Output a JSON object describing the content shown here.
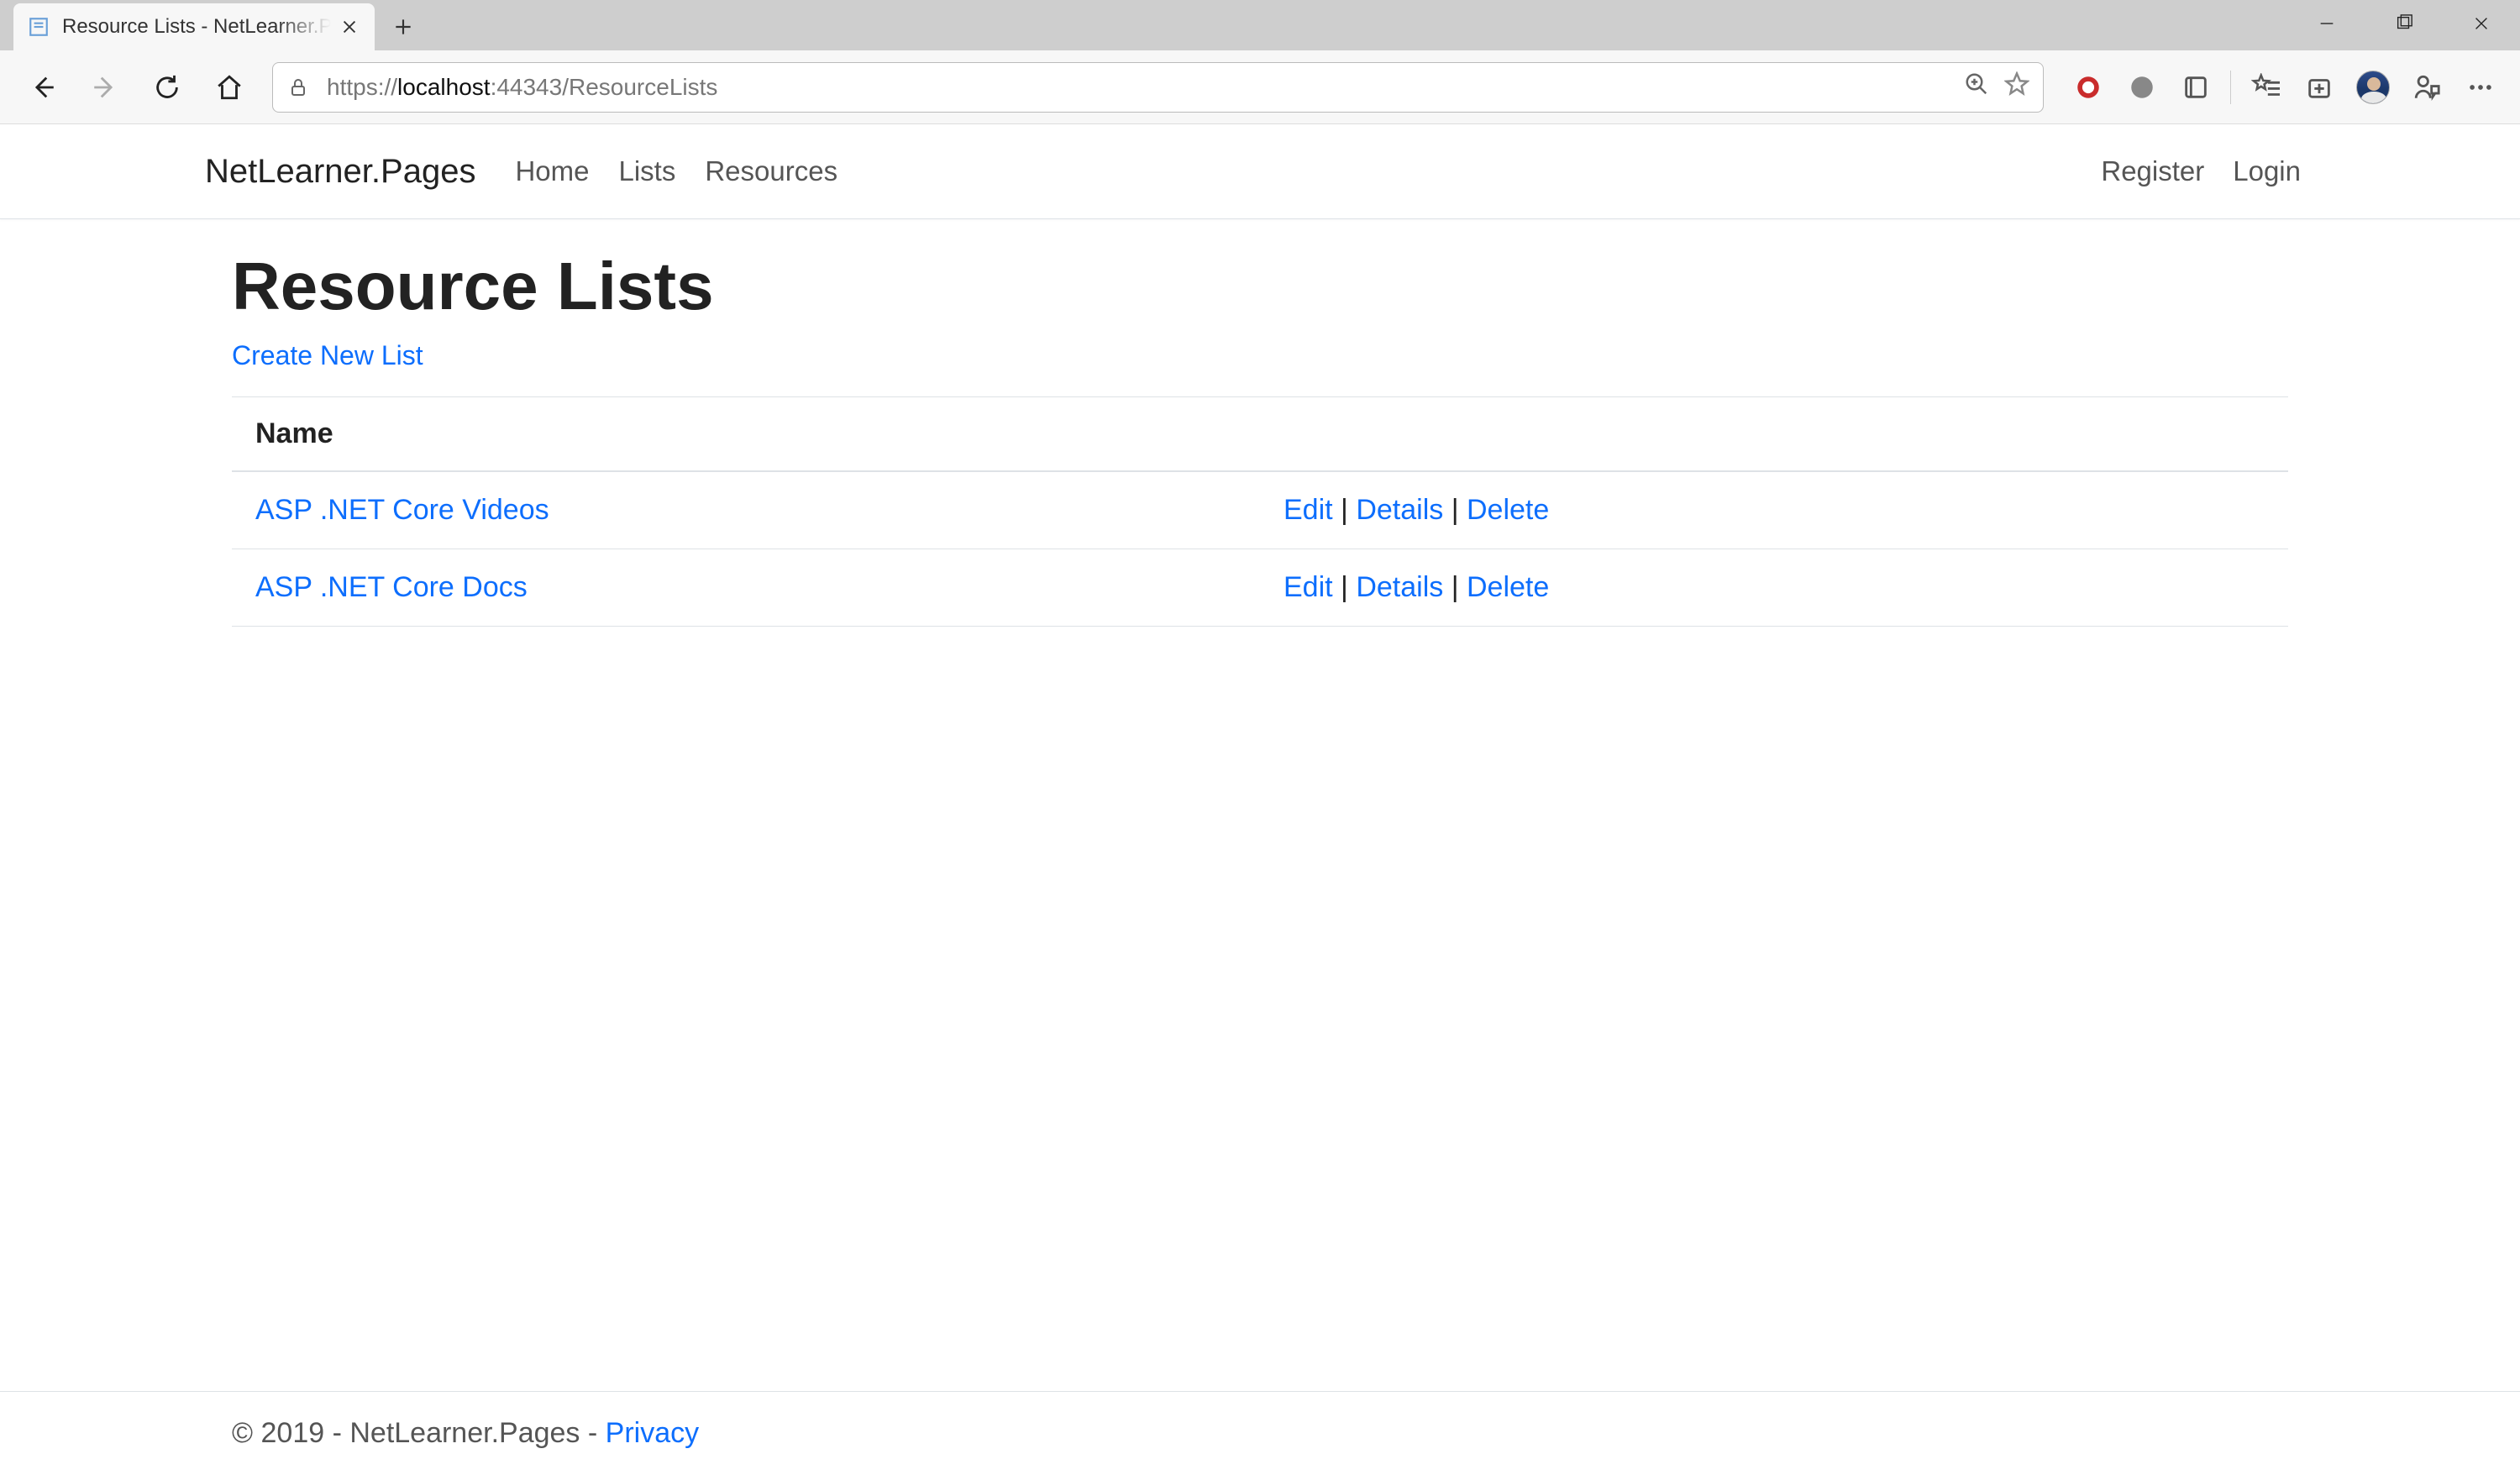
{
  "browser": {
    "tab_title": "Resource Lists - NetLearner.Pages",
    "url_protocol": "https://",
    "url_host": "localhost",
    "url_rest": ":44343/ResourceLists"
  },
  "nav": {
    "brand": "NetLearner.Pages",
    "links": [
      "Home",
      "Lists",
      "Resources"
    ],
    "right": [
      "Register",
      "Login"
    ]
  },
  "page": {
    "title": "Resource Lists",
    "create_link": "Create New List",
    "table": {
      "headers": [
        "Name",
        ""
      ],
      "rows": [
        {
          "name": "ASP .NET Core Videos",
          "actions": [
            "Edit",
            "Details",
            "Delete"
          ]
        },
        {
          "name": "ASP .NET Core Docs",
          "actions": [
            "Edit",
            "Details",
            "Delete"
          ]
        }
      ],
      "action_sep": " | "
    }
  },
  "footer": {
    "text": "© 2019 - NetLearner.Pages - ",
    "privacy": "Privacy"
  }
}
